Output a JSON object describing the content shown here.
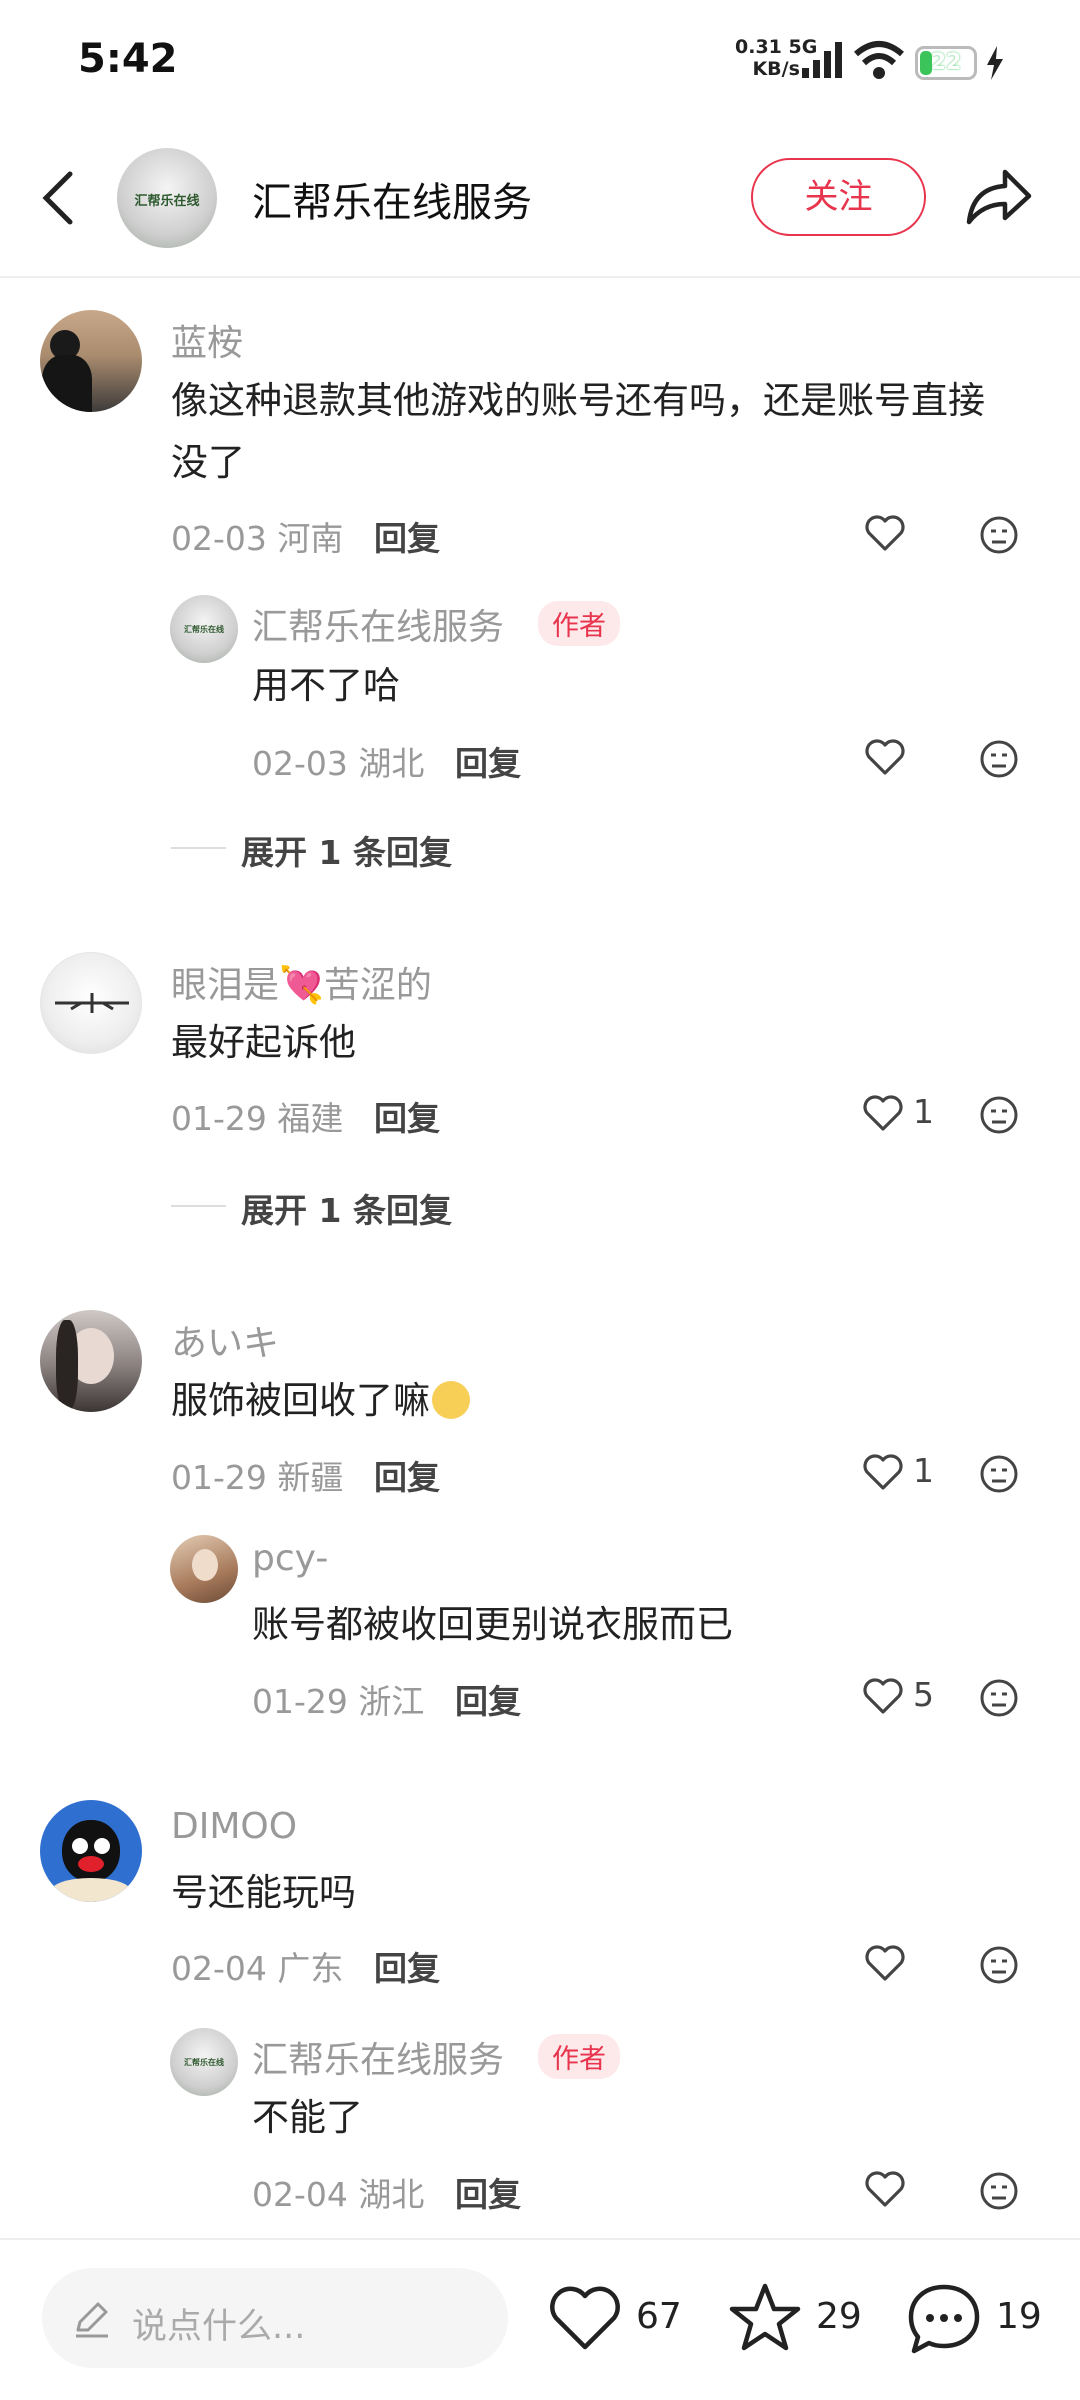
{
  "status": {
    "time": "5:42",
    "net_speed_value": "0.31",
    "net_type": "5G",
    "net_speed_unit": "KB/s",
    "battery": "22"
  },
  "header": {
    "title": "汇帮乐在线服务",
    "follow": "关注",
    "avatar_text": "汇帮乐在线"
  },
  "author_tag": "作者",
  "reply_label": "回复",
  "expand_label": "展开 1 条回复",
  "comments": [
    {
      "user": "蓝桉",
      "text_line1": "像这种退款其他游戏的账号还有吗，还是账号直接",
      "text_line2": "没了",
      "meta": "02-03 河南",
      "likes": "",
      "reply": {
        "user": "汇帮乐在线服务",
        "text": "用不了哈",
        "meta": "02-03 湖北",
        "likes": ""
      }
    },
    {
      "user_part1": "眼泪是",
      "user_part2": "苦涩的",
      "text": "最好起诉他",
      "meta": "01-29 福建",
      "likes": "1"
    },
    {
      "user": "あいキ",
      "text": "服饰被回收了嘛",
      "meta": "01-29 新疆",
      "likes": "1",
      "reply": {
        "user": "pcy-",
        "text": "账号都被收回更别说衣服而已",
        "meta": "01-29 浙江",
        "likes": "5"
      }
    },
    {
      "user": "DIMOO",
      "text": "号还能玩吗",
      "meta": "02-04 广东",
      "likes": "",
      "reply": {
        "user": "汇帮乐在线服务",
        "text": "不能了",
        "meta": "02-04 湖北",
        "likes": ""
      }
    }
  ],
  "bottom": {
    "placeholder": "说点什么...",
    "likes": "67",
    "stars": "29",
    "comments": "19"
  },
  "colors": {
    "accent": "#e8344d",
    "battery": "#3bc45a"
  },
  "icons": [
    "back-arrow-icon",
    "share-icon",
    "heart-icon",
    "dislike-face-icon",
    "pencil-icon",
    "star-icon",
    "comment-bubble-icon",
    "signal-icon",
    "wifi-icon",
    "battery-icon",
    "charging-icon",
    "heart-emoji-icon",
    "smile-emoji-icon"
  ]
}
